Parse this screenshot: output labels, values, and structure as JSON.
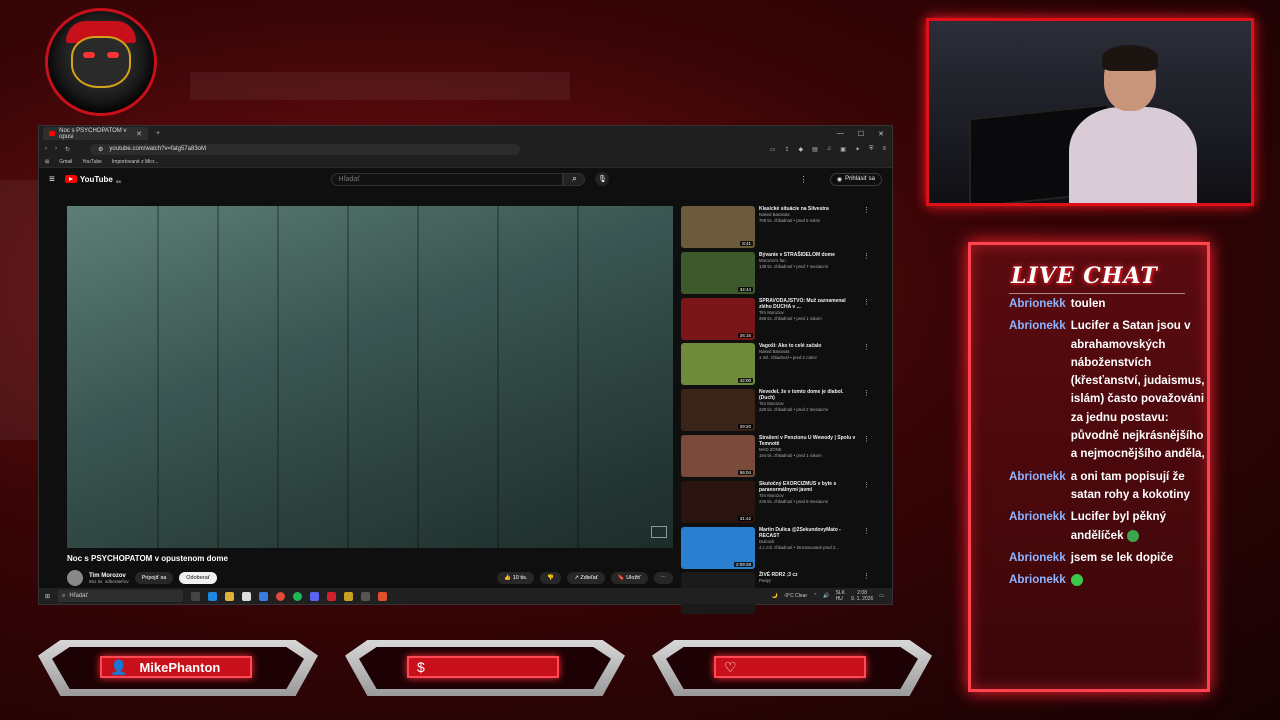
{
  "browser": {
    "tab_title": "Noc s PSYCHOPATOM v opusi",
    "url": "youtube.com/watch?v=fatg57a83oM",
    "bookmarks": [
      "Gmail",
      "YouTube",
      "Importované z Micr..."
    ]
  },
  "youtube": {
    "logo_text": "YouTube",
    "region": "SK",
    "search_placeholder": "Hľadať",
    "signin_label": "Prihlásiť sa",
    "video_title": "Noc s PSYCHOPATOM v opustenom dome",
    "channel_name": "Tim Morozov",
    "channel_subs": "661 tis. odberateľov",
    "join_label": "Pripojiť sa",
    "subscribe_label": "Odoberať",
    "like_label": "10 tis.",
    "share_label": "Zdieľať",
    "save_label": "Uložiť"
  },
  "related": [
    {
      "title": "Klasické situácie na Silvestra",
      "channel": "Naked Bananas",
      "meta": "709 tis. zhliadnutí • pred 5 rokmi",
      "duration": "8:41",
      "color": "#6b5a3c"
    },
    {
      "title": "Bývanie v STRAŠIDELOM dome",
      "channel": "Morozov's fan",
      "meta": "139 tis. zhliadnutí • pred 7 mesiacmi",
      "duration": "34:44",
      "color": "#3e5a2c"
    },
    {
      "title": "SPRAVODAJSTVO: Muž zaznamenal zlého DUCHA v ...",
      "channel": "Tim Morozov",
      "meta": "268 tis. zhliadnutí • pred 1 rokom",
      "duration": "26:16",
      "color": "#7a1518"
    },
    {
      "title": "Vagoši: Ako to celé začalo",
      "channel": "Naked Bananas",
      "meta": "1 mil. zhliadnutí • pred 2 rokmi",
      "duration": "42:00",
      "color": "#6f8a3a"
    },
    {
      "title": "Nevedel, že v tomto dome je diabol. (Duch)",
      "channel": "Tim Morozov",
      "meta": "229 tis. zhliadnutí • pred 2 mesiacmi",
      "duration": "29:20",
      "color": "#3a2418"
    },
    {
      "title": "Strašení v Penzionu U Wewody | Spolu v Temnotě",
      "channel": "MAD ZONE",
      "meta": "194 tis. zhliadnutí • pred 1 rokom",
      "duration": "56:04",
      "color": "#7a4a3a"
    },
    {
      "title": "Skutočný EXORCIZMUS v byte s paranormálnymi javmi",
      "channel": "Tim Morozov",
      "meta": "246 tis. zhliadnutí • pred 8 mesiacmi",
      "duration": "31:42",
      "color": "#2a1410"
    },
    {
      "title": "Martin Dulica @2SekundovyMato - RECAST",
      "channel": "Dulcock",
      "meta": "4,1 mil. zhliadnutí • Streamované pred 2...",
      "duration": "2:09:28",
      "color": "#2a7fd0"
    },
    {
      "title": "ŽIVÉ RDR2 ;3 cz",
      "channel": "Pedyy",
      "meta": "",
      "duration": "",
      "color": "#1a1a1a"
    }
  ],
  "taskbar": {
    "search_label": "Hľadať",
    "weather": "-9°C  Clear",
    "lang": "SLK\nHU",
    "time": "2:08",
    "date": "9. 1. 2026"
  },
  "chat": {
    "title": "LIVE CHAT",
    "messages": [
      {
        "user": "Abrionekk",
        "text": "toulen"
      },
      {
        "user": "Abrionekk",
        "text": "Lucifer a Satan jsou v abrahamovských náboženstvích (křesťanství, judaismus, islám) často považováni za jednu postavu: původně nejkrásnějšího a nejmocnějšího anděla,"
      },
      {
        "user": "Abrionekk",
        "text": "a oni tam popisují že satan rohy a kokotiny"
      },
      {
        "user": "Abrionekk",
        "text": "Lucifer byl pěkný andělíček"
      },
      {
        "user": "Abrionekk",
        "text": "jsem se lek dopiče"
      },
      {
        "user": "Abrionekk",
        "text": ""
      }
    ]
  },
  "panels": [
    {
      "icon": "user-icon",
      "label": "MikePhanton"
    },
    {
      "icon": "dollar-icon",
      "label": ""
    },
    {
      "icon": "heart-icon",
      "label": ""
    }
  ],
  "colors": {
    "accent": "#e0101a",
    "chat_user": "#8fb3ff",
    "youtube_red": "#ff0000"
  }
}
